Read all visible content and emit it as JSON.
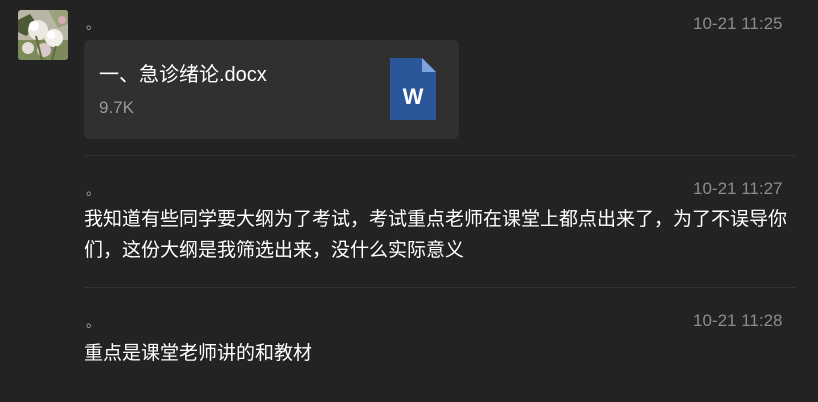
{
  "messages": [
    {
      "sender": "。",
      "time": "10-21 11:25",
      "file": {
        "name": "一、急诊绪论.docx",
        "size": "9.7K",
        "icon": "word-document-icon",
        "icon_letter": "W",
        "icon_color": "#2b579a"
      }
    },
    {
      "sender": "。",
      "time": "10-21 11:27",
      "text": "我知道有些同学要大纲为了考试，考试重点老师在课堂上都点出来了，为了不误导你们，这份大纲是我筛选出来，没什么实际意义"
    },
    {
      "sender": "。",
      "time": "10-21 11:28",
      "text": "重点是课堂老师讲的和教材"
    }
  ]
}
